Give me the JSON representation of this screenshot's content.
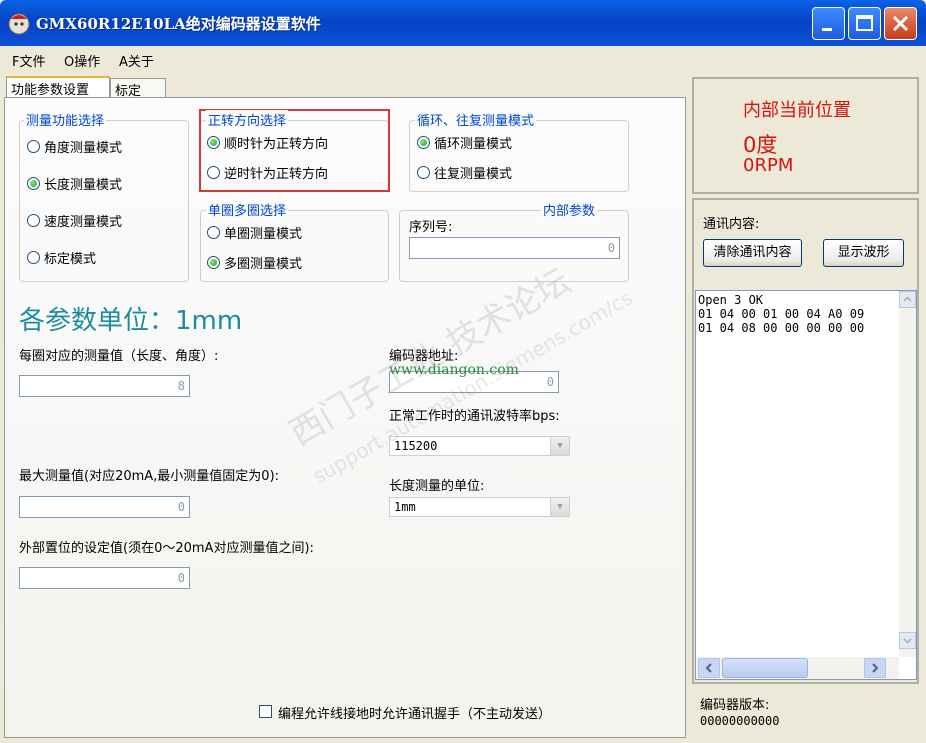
{
  "window": {
    "title": "GMX60R12E10LA绝对编码器设置软件"
  },
  "menu": {
    "file": "F文件",
    "operate": "O操作",
    "about": "A关于"
  },
  "tabs": {
    "params": "功能参数设置",
    "calib": "标定"
  },
  "measure_func": {
    "title": "测量功能选择",
    "options": [
      "角度测量模式",
      "长度测量模式",
      "速度测量模式",
      "标定模式"
    ],
    "selected": "长度测量模式"
  },
  "direction": {
    "title": "正转方向选择",
    "options": [
      "顺时针为正转方向",
      "逆时针为正转方向"
    ],
    "selected": "顺时针为正转方向"
  },
  "loop_mode": {
    "title": "循环、往复测量模式",
    "options": [
      "循环测量模式",
      "往复测量模式"
    ],
    "selected": "循环测量模式"
  },
  "turn_mode": {
    "title": "单圈多圈选择",
    "options": [
      "单圈测量模式",
      "多圈测量模式"
    ],
    "selected": "多圈测量模式"
  },
  "internal": {
    "title": "内部参数",
    "serial_label": "序列号:",
    "serial_value": "0"
  },
  "units_heading": "各参数单位：1mm",
  "per_turn": {
    "label": "每圈对应的测量值（长度、角度）:",
    "value": "8"
  },
  "max_value": {
    "label": "最大测量值(对应20mA,最小测量值固定为0):",
    "value": "0"
  },
  "preset": {
    "label": "外部置位的设定值(须在0～20mA对应测量值之间):",
    "value": "0"
  },
  "address": {
    "label": "编码器地址:",
    "value": "0"
  },
  "baud": {
    "label": "正常工作时的通讯波特率bps:",
    "value": "115200"
  },
  "length_unit": {
    "label": "长度测量的单位:",
    "value": "1mm"
  },
  "handshake_checkbox": {
    "label": "编程允许线接地时允许通讯握手（不主动发送）",
    "checked": false
  },
  "position": {
    "title": "内部当前位置",
    "degree": "0度",
    "rpm": "0RPM"
  },
  "comm": {
    "label": "通讯内容:",
    "clear_button": "清除通讯内容",
    "wave_button": "显示波形",
    "log": [
      "Open 3 OK",
      "01 04 00 01 00 04 A0 09",
      "01 04 08 00 00 00 00 00"
    ]
  },
  "version": {
    "label": "编码器版本:",
    "value": "00000000000"
  },
  "watermark": {
    "site": "www.diangon.com",
    "cn": "西门子工业 技术论坛",
    "en": "support.automation.siemens.com/cs"
  },
  "colors": {
    "accent_red": "#D9120C",
    "group_title": "#0046D5",
    "teal_heading": "#1E8CA0",
    "highlight_box": "#D33B3B"
  }
}
